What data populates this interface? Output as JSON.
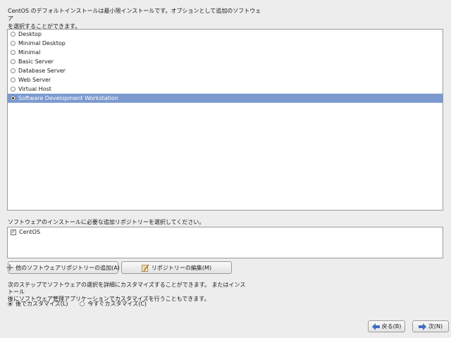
{
  "intro": {
    "text": "CentOS のデフォルトインストールは最小限インストールです。オプションとして追加のソフトウェア\nを選択することができます。"
  },
  "environments": {
    "items": [
      {
        "label": "Desktop",
        "selected": false
      },
      {
        "label": "Minimal Desktop",
        "selected": false
      },
      {
        "label": "Minimal",
        "selected": false
      },
      {
        "label": "Basic Server",
        "selected": false
      },
      {
        "label": "Database Server",
        "selected": false
      },
      {
        "label": "Web Server",
        "selected": false
      },
      {
        "label": "Virtual Host",
        "selected": false
      },
      {
        "label": "Software Development Workstation",
        "selected": true
      }
    ]
  },
  "repositories": {
    "label": "ソフトウェアのインストールに必要な追加リポジトリーを選択してください。",
    "items": [
      {
        "label": "CentOS",
        "checked": true
      }
    ]
  },
  "buttons": {
    "add_repo": "他のソフトウェアリポジトリーの追加(A)",
    "edit_repo": "リポジトリーの編集(M)",
    "back": "戻る(B)",
    "next": "次(N)"
  },
  "customize": {
    "text": "次のステップでソフトウェアの選択を詳細にカスタマイズすることができます。 またはインストール\n後にソフトウェア管理アプリケーションでカスタマイズを行うこともできます。",
    "later_label": "後でカスタマイズ(L)",
    "now_label": "今すぐカスタマイズ(C)",
    "selected": "later"
  },
  "colors": {
    "selection": "#7c9ad0",
    "background": "#ededed",
    "arrow_blue": "#3d6fbf"
  }
}
